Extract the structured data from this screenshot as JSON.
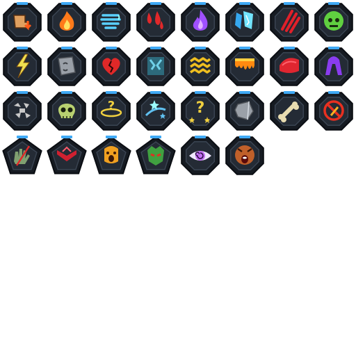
{
  "sheet": {
    "background": "#ffffff",
    "frame_color": "#161b22",
    "tab_color": "#3fa9f5"
  },
  "icons": [
    {
      "name": "stomp-down-icon",
      "shape": "oct",
      "icon": "stomp",
      "color": "#e0a060"
    },
    {
      "name": "fire-icon",
      "shape": "oct",
      "icon": "fire",
      "color": "#ff7a1a"
    },
    {
      "name": "whirlwind-icon",
      "shape": "oct",
      "icon": "wind",
      "color": "#5ad0ff"
    },
    {
      "name": "blood-drops-icon",
      "shape": "oct",
      "icon": "drops",
      "color": "#e0282a"
    },
    {
      "name": "arcane-flame-icon",
      "shape": "oct",
      "icon": "purpleflame",
      "color": "#a050ff"
    },
    {
      "name": "ice-shards-icon",
      "shape": "oct",
      "icon": "ice",
      "color": "#36a8f0"
    },
    {
      "name": "claw-slash-icon",
      "shape": "oct",
      "icon": "claws",
      "color": "#e0202a"
    },
    {
      "name": "poison-skull-icon",
      "shape": "oct",
      "icon": "poison",
      "color": "#60d040"
    },
    {
      "name": "lightning-strike-icon",
      "shape": "oct",
      "icon": "zap",
      "color": "#f0e050"
    },
    {
      "name": "stone-face-icon",
      "shape": "oct",
      "icon": "stoneface",
      "color": "#9aa0a8"
    },
    {
      "name": "broken-heart-icon",
      "shape": "oct",
      "icon": "heartbreak",
      "color": "#e02828"
    },
    {
      "name": "frozen-crack-icon",
      "shape": "oct",
      "icon": "frozen",
      "color": "#70d0e8"
    },
    {
      "name": "shock-waves-icon",
      "shape": "oct",
      "icon": "shock",
      "color": "#f0c020"
    },
    {
      "name": "lava-drip-icon",
      "shape": "oct",
      "icon": "lava",
      "color": "#ff8a10"
    },
    {
      "name": "red-cloak-icon",
      "shape": "oct",
      "icon": "cloak",
      "color": "#e02630"
    },
    {
      "name": "shadow-arch-icon",
      "shape": "oct",
      "icon": "shadow",
      "color": "#8a3cf0"
    },
    {
      "name": "shatter-icon",
      "shape": "oct",
      "icon": "shatter",
      "color": "#c8c8c8"
    },
    {
      "name": "skull-icon",
      "shape": "oct",
      "icon": "skull",
      "color": "#b8d070"
    },
    {
      "name": "confusion-icon",
      "shape": "oct",
      "icon": "confuse",
      "color": "#f0d040"
    },
    {
      "name": "starry-daze-icon",
      "shape": "oct",
      "icon": "daze",
      "color": "#60c0f0"
    },
    {
      "name": "dizzy-stars-icon",
      "shape": "oct",
      "icon": "dizzy",
      "color": "#f0d040"
    },
    {
      "name": "stone-icon",
      "shape": "oct",
      "icon": "stone",
      "color": "#9aa0a8"
    },
    {
      "name": "bone-break-icon",
      "shape": "oct",
      "icon": "bone",
      "color": "#e8dcb0"
    },
    {
      "name": "no-attack-icon",
      "shape": "oct",
      "icon": "noattack",
      "color": "#e83020"
    },
    {
      "name": "hand-slash-icon",
      "shape": "pent",
      "icon": "hand",
      "color": "#80a070"
    },
    {
      "name": "demon-chevron-icon",
      "shape": "pent",
      "icon": "demon",
      "color": "#d02030"
    },
    {
      "name": "scream-icon",
      "shape": "pent",
      "icon": "scream",
      "color": "#f0a020"
    },
    {
      "name": "green-fiend-icon",
      "shape": "pent",
      "icon": "fiend",
      "color": "#40a040"
    },
    {
      "name": "hypno-eye-icon",
      "shape": "oct",
      "icon": "eye",
      "color": "#c070f0"
    },
    {
      "name": "terror-face-icon",
      "shape": "oct",
      "icon": "terror",
      "color": "#c0602a"
    }
  ]
}
